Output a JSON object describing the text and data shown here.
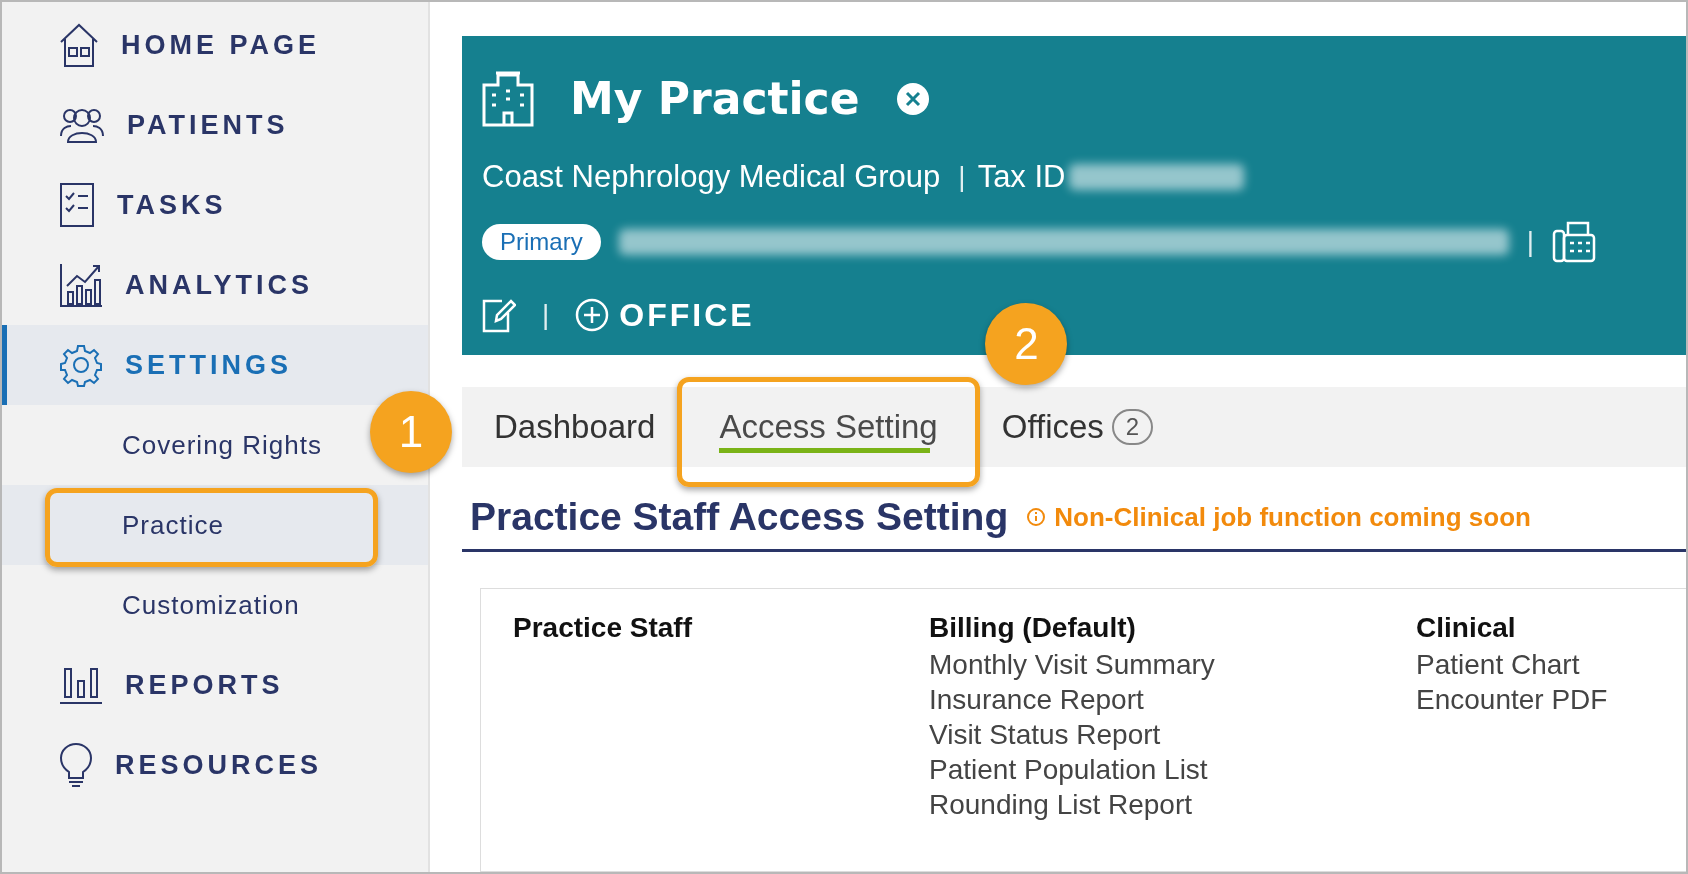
{
  "sidebar": {
    "items": [
      {
        "kind": "nav",
        "label": "HOME PAGE",
        "selected": false
      },
      {
        "kind": "nav",
        "label": "PATIENTS",
        "selected": false
      },
      {
        "kind": "nav",
        "label": "TASKS",
        "selected": false
      },
      {
        "kind": "nav",
        "label": "ANALYTICS",
        "selected": false
      },
      {
        "kind": "nav",
        "label": "SETTINGS",
        "selected": true
      },
      {
        "kind": "sub",
        "label": "Covering Rights",
        "selected": false
      },
      {
        "kind": "sub",
        "label": "Practice",
        "selected": true,
        "callout": "1"
      },
      {
        "kind": "sub",
        "label": "Customization",
        "selected": false
      },
      {
        "kind": "nav",
        "label": "REPORTS",
        "selected": false
      },
      {
        "kind": "nav",
        "label": "RESOURCES",
        "selected": false
      }
    ]
  },
  "header": {
    "title": "My Practice",
    "group": "Coast Nephrology Medical Group",
    "separator": "|",
    "tax_label": "Tax ID",
    "primary_badge": "Primary",
    "address_separator": "|",
    "add_office": "OFFICE",
    "action_separator": "|"
  },
  "tabs": [
    {
      "label": "Dashboard",
      "selected": false
    },
    {
      "label": "Access Setting",
      "selected": true,
      "callout": "2"
    },
    {
      "label": "Offices",
      "selected": false,
      "count": "2"
    }
  ],
  "section": {
    "title": "Practice Staff Access Setting",
    "notice": "Non-Clinical job function coming soon"
  },
  "access_table": {
    "columns": [
      {
        "heading": "Practice Staff"
      },
      {
        "heading": "Billing (Default)",
        "items": [
          "Monthly Visit Summary",
          "Insurance Report",
          "Visit Status Report",
          "Patient Population List",
          "Rounding List Report"
        ]
      },
      {
        "heading": "Clinical",
        "items": [
          "Patient Chart",
          "Encounter PDF"
        ]
      }
    ]
  }
}
